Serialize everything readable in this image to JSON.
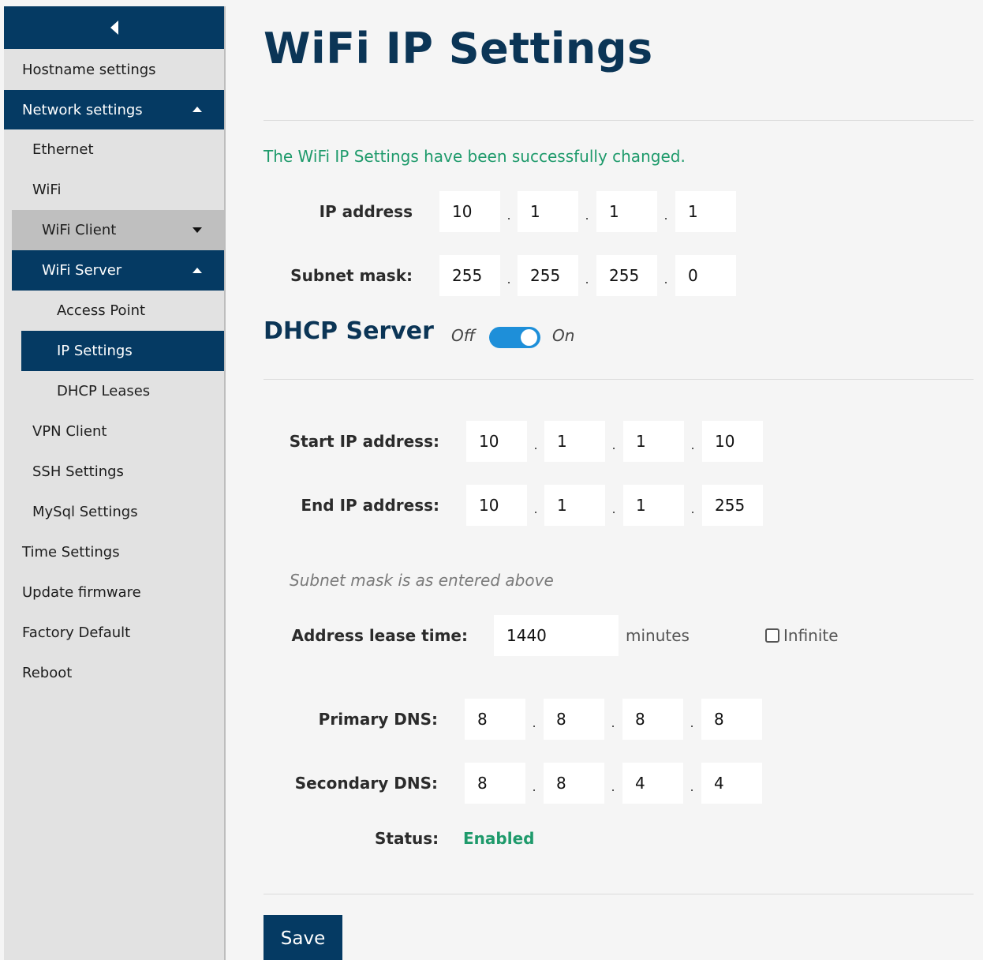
{
  "sidebar": {
    "collapse_label": "",
    "items": [
      {
        "label": "Hostname settings"
      },
      {
        "label": "Network settings"
      },
      {
        "label": "Ethernet"
      },
      {
        "label": "WiFi"
      },
      {
        "label": "WiFi Client"
      },
      {
        "label": "WiFi Server"
      },
      {
        "label": "Access Point"
      },
      {
        "label": "IP Settings"
      },
      {
        "label": "DHCP Leases"
      },
      {
        "label": "VPN Client"
      },
      {
        "label": "SSH Settings"
      },
      {
        "label": "MySql Settings"
      },
      {
        "label": "Time Settings"
      },
      {
        "label": "Update firmware"
      },
      {
        "label": "Factory Default"
      },
      {
        "label": "Reboot"
      }
    ]
  },
  "page": {
    "title": "WiFi IP Settings",
    "success_message": "The WiFi IP Settings have been successfully changed."
  },
  "ip": {
    "ip_address_label": "IP address",
    "ip_address": [
      "10",
      "1",
      "1",
      "1"
    ],
    "subnet_mask_label": "Subnet mask:",
    "subnet_mask": [
      "255",
      "255",
      "255",
      "0"
    ]
  },
  "dhcp": {
    "heading": "DHCP Server",
    "toggle_off_label": "Off",
    "toggle_on_label": "On",
    "enabled": true,
    "start_label": "Start IP address:",
    "start": [
      "10",
      "1",
      "1",
      "10"
    ],
    "end_label": "End IP address:",
    "end": [
      "10",
      "1",
      "1",
      "255"
    ],
    "subnet_hint": "Subnet mask is as entered above",
    "lease_label": "Address lease time:",
    "lease_value": "1440",
    "lease_unit": "minutes",
    "infinite_label": "Infinite",
    "infinite_checked": false,
    "primary_dns_label": "Primary DNS:",
    "primary_dns": [
      "8",
      "8",
      "8",
      "8"
    ],
    "secondary_dns_label": "Secondary DNS:",
    "secondary_dns": [
      "8",
      "8",
      "4",
      "4"
    ],
    "status_label": "Status:",
    "status_value": "Enabled"
  },
  "actions": {
    "save_label": "Save"
  },
  "colors": {
    "nav_active": "#053a63",
    "title": "#0b3556",
    "success": "#1e9a6b",
    "toggle": "#1e8fd9"
  }
}
